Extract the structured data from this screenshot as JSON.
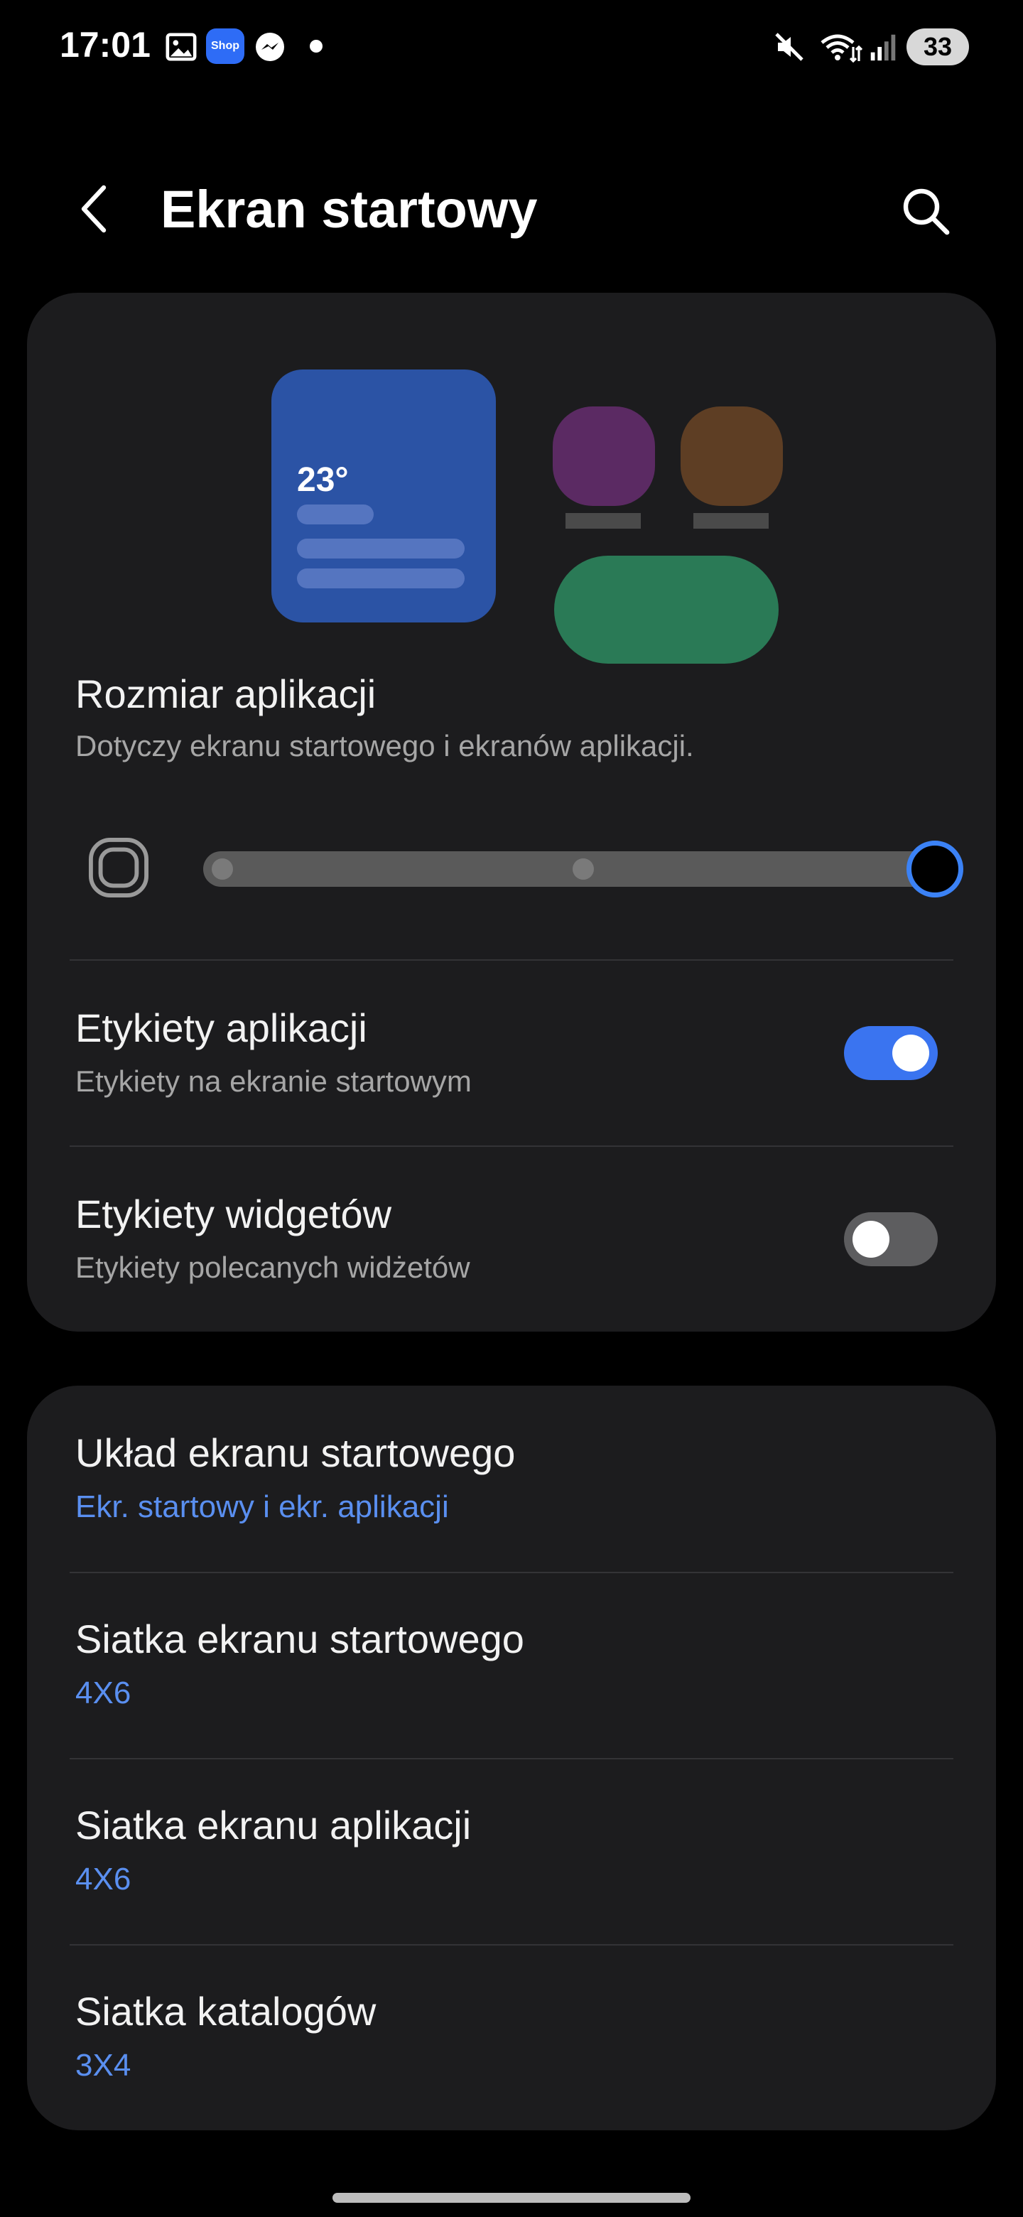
{
  "status_bar": {
    "time": "17:01",
    "shop_badge": "Shop",
    "battery": "33",
    "icons": [
      "image-icon",
      "shop-icon",
      "messenger-icon",
      "dot-icon",
      "mute-icon",
      "wifi-icon",
      "signal-icon",
      "battery-icon"
    ]
  },
  "header": {
    "title": "Ekran startowy",
    "back_icon": "back-arrow-icon",
    "search_icon": "search-icon"
  },
  "preview": {
    "widget_temp": "23°",
    "colors": {
      "widget": "#2b53a5",
      "app_purple": "#5b2a63",
      "app_brown": "#5e3e24",
      "pill": "#2a7a56"
    }
  },
  "app_size": {
    "title": "Rozmiar aplikacji",
    "subtitle": "Dotyczy ekranu startowego i ekranów aplikacji.",
    "slider_steps": 3,
    "slider_selected_step": 3
  },
  "app_labels": {
    "title": "Etykiety aplikacji",
    "subtitle": "Etykiety na ekranie startowym",
    "enabled": true
  },
  "widget_labels": {
    "title": "Etykiety widgetów",
    "subtitle": "Etykiety polecanych widżetów",
    "enabled": false
  },
  "settings": [
    {
      "title": "Układ ekranu startowego",
      "value": "Ekr. startowy i ekr. aplikacji"
    },
    {
      "title": "Siatka ekranu startowego",
      "value": "4X6"
    },
    {
      "title": "Siatka ekranu aplikacji",
      "value": "4X6"
    },
    {
      "title": "Siatka katalogów",
      "value": "3X4"
    }
  ],
  "accent_color": "#3a74f0"
}
